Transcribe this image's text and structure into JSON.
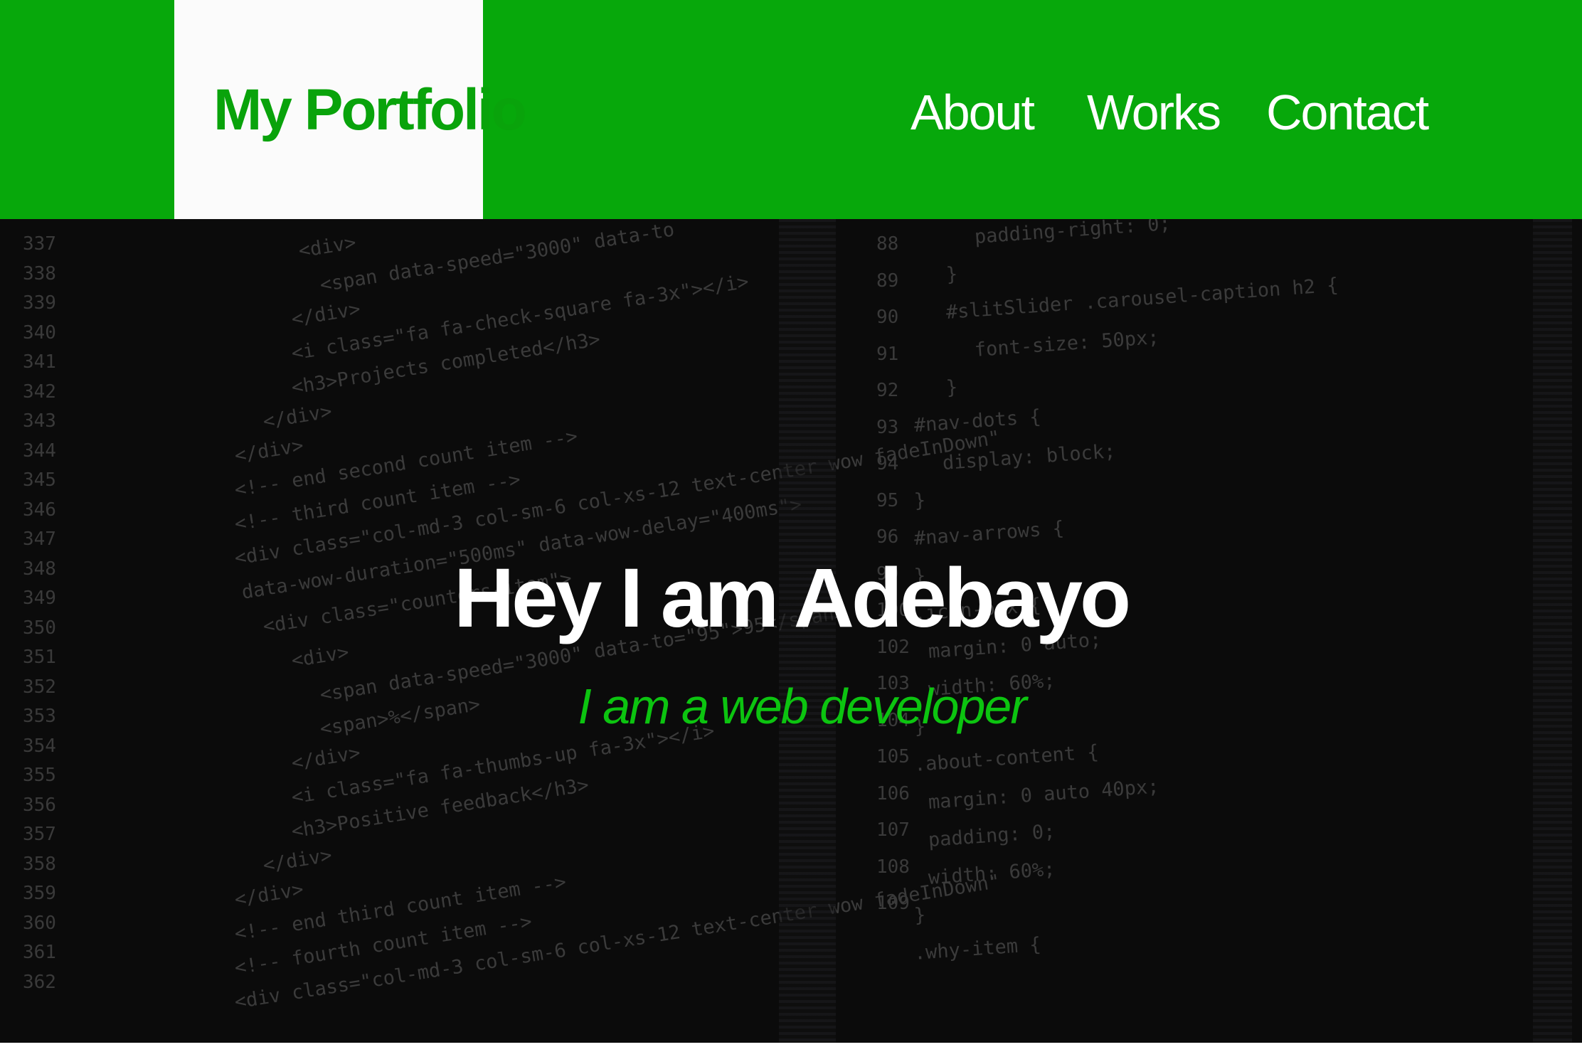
{
  "header": {
    "logo": "My Portfolio",
    "nav": [
      "About",
      "Works",
      "Contact"
    ]
  },
  "hero": {
    "title": "Hey I am Adebayo",
    "subtitle": "I am a web developer"
  },
  "background_code": {
    "left_gutter": [
      "337",
      "338",
      "339",
      "340",
      "341",
      "342",
      "343",
      "344",
      "345",
      "346",
      "347",
      "348",
      "349",
      "350",
      "351",
      "352",
      "353",
      "354",
      "355",
      "356",
      "357",
      "358",
      "359",
      "360",
      "361",
      "362"
    ],
    "left_lines": [
      "<div>",
      "<span data-speed=\"3000\" data-to",
      "</div>",
      "<i class=\"fa fa-check-square fa-3x\"></i>",
      "<h3>Projects completed</h3>",
      "</div>",
      "</div>",
      "<!-- end second count item -->",
      "<!-- third count item -->",
      "<div class=\"col-md-3 col-sm-6 col-xs-12 text-center wow fadeInDown\"",
      "data-wow-duration=\"500ms\" data-wow-delay=\"400ms\">",
      "<div class=\"counters-item\">",
      "<div>",
      "<span data-speed=\"3000\" data-to=\"95\">95</span>",
      "<span>%</span>",
      "</div>",
      "<i class=\"fa fa-thumbs-up fa-3x\"></i>",
      "<h3>Positive feedback</h3>",
      "</div>",
      "</div>",
      "<!-- end third count item -->",
      "<!-- fourth count item -->",
      "<div class=\"col-md-3 col-sm-6 col-xs-12 text-center wow fadeInDown\""
    ],
    "right_gutter": [
      "88",
      "89",
      "90",
      "91",
      "92",
      "93",
      "94",
      "95",
      "96",
      "99",
      "100",
      "102",
      "103",
      "104",
      "105",
      "106",
      "107",
      "108",
      "109"
    ],
    "right_lines": [
      "padding-right: 0;",
      "}",
      "#slitSlider .carousel-caption h2 {",
      "font-size: 50px;",
      "}",
      "#nav-dots {",
      "display: block;",
      "}",
      "#nav-arrows {",
      "}",
      ".icon-box {",
      "margin: 0 auto;",
      "width: 60%;",
      "}",
      ".about-content {",
      "margin: 0 auto 40px;",
      "padding: 0;",
      "width: 60%;",
      "}",
      ".why-item {"
    ]
  },
  "colors": {
    "brand_green": "#07a80b",
    "logo_green": "#09a30b",
    "subtitle_green": "#0cc410",
    "hero_background": "#0b0b0b"
  }
}
